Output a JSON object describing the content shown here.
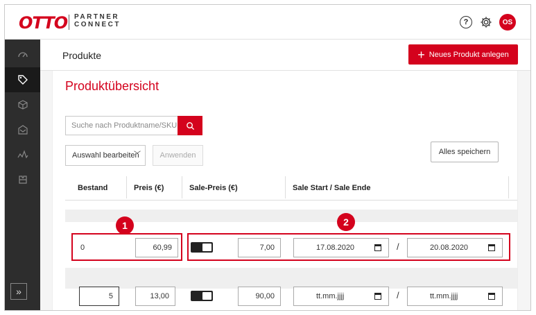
{
  "header": {
    "logo": "OTTO",
    "brand_line1": "PARTNER",
    "brand_line2": "CONNECT",
    "help_symbol": "?",
    "avatar_initials": "OS"
  },
  "sidebar": {
    "items": [
      "dashboard-icon",
      "tag-icon",
      "box-icon",
      "return-icon",
      "analytics-icon",
      "puzzle-icon"
    ],
    "active_index": 1,
    "collapse_label": "»"
  },
  "page": {
    "title": "Produkte",
    "new_product_label": "Neues Produkt anlegen"
  },
  "panel": {
    "heading": "Produktübersicht",
    "search_placeholder": "Suche nach Produktname/SKU",
    "bulk_select_value": "Auswahl bearbeiten",
    "apply_label": "Anwenden",
    "save_all_label": "Alles speichern"
  },
  "table": {
    "columns": [
      "Bestand",
      "Preis (€)",
      "Sale-Preis (€)",
      "Sale Start / Sale Ende"
    ],
    "rows": [
      {
        "stock": "0",
        "price": "60,99",
        "sale_active": true,
        "sale_price": "7,00",
        "sale_start": "17.08.2020",
        "sale_end": "20.08.2020"
      },
      {
        "stock": "5",
        "price": "13,00",
        "sale_active": true,
        "sale_price": "90,00",
        "sale_start": "tt.mm.jjjj",
        "sale_end": "tt.mm.jjjj"
      }
    ],
    "date_separator": "/"
  },
  "annotations": {
    "badge1": "1",
    "badge2": "2"
  },
  "colors": {
    "accent": "#d4021d",
    "sidebar": "#2d2d2d"
  }
}
